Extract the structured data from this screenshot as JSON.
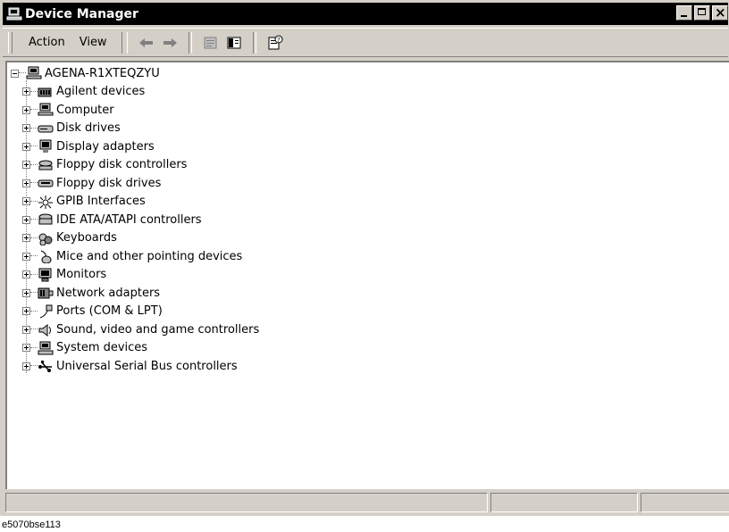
{
  "window": {
    "title": "Device Manager"
  },
  "menu": {
    "action_label": "Action",
    "view_label": "View"
  },
  "toolbar": {
    "buttons": [
      "back-arrow-icon",
      "forward-arrow-icon",
      "properties-icon",
      "show-hide-tree-icon",
      "help-icon"
    ]
  },
  "tree": {
    "root": "AGENA-R1XTEQZYU",
    "items": [
      {
        "label": "Agilent devices",
        "icon": "agilent-device-icon"
      },
      {
        "label": "Computer",
        "icon": "computer-icon"
      },
      {
        "label": "Disk drives",
        "icon": "disk-drive-icon"
      },
      {
        "label": "Display adapters",
        "icon": "display-adapter-icon"
      },
      {
        "label": "Floppy disk controllers",
        "icon": "floppy-controller-icon"
      },
      {
        "label": "Floppy disk drives",
        "icon": "floppy-drive-icon"
      },
      {
        "label": "GPIB Interfaces",
        "icon": "gpib-icon"
      },
      {
        "label": "IDE ATA/ATAPI controllers",
        "icon": "ide-controller-icon"
      },
      {
        "label": "Keyboards",
        "icon": "keyboard-icon"
      },
      {
        "label": "Mice and other pointing devices",
        "icon": "mouse-icon"
      },
      {
        "label": "Monitors",
        "icon": "monitor-icon"
      },
      {
        "label": "Network adapters",
        "icon": "network-adapter-icon"
      },
      {
        "label": "Ports (COM & LPT)",
        "icon": "port-icon"
      },
      {
        "label": "Sound, video and game controllers",
        "icon": "sound-icon"
      },
      {
        "label": "System devices",
        "icon": "system-device-icon"
      },
      {
        "label": "Universal Serial Bus controllers",
        "icon": "usb-icon"
      }
    ]
  },
  "statusbar": {
    "panels": [
      "",
      "",
      ""
    ]
  },
  "figure_caption": "e5070bse113"
}
